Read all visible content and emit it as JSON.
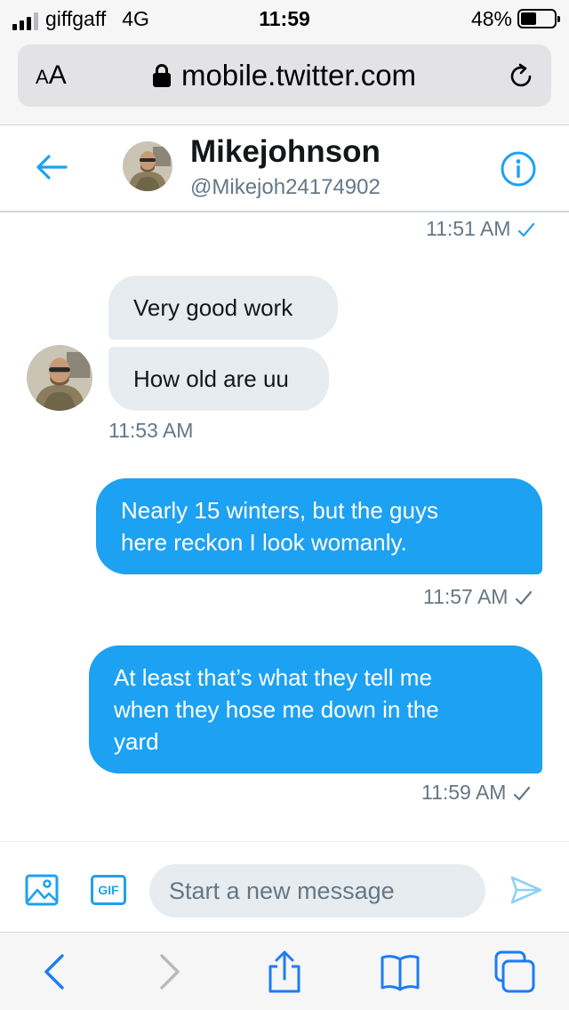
{
  "status_bar": {
    "carrier": "giffgaff",
    "network": "4G",
    "time": "11:59",
    "battery": "48%",
    "battery_level": 0.48,
    "signal_bars": 3,
    "signal_max": 4
  },
  "browser": {
    "text_size_button": "AA",
    "url": "mobile.twitter.com",
    "lock_icon": "lock-icon",
    "reload_icon": "reload-icon"
  },
  "header": {
    "back_icon": "back-arrow-icon",
    "name": "Mikejohnson",
    "handle": "@Mikejoh24174902",
    "info_icon": "info-icon"
  },
  "conversation": {
    "top_timestamp": "11:51 AM",
    "received": {
      "messages": [
        "Very good work",
        "How old are uu"
      ],
      "timestamp": "11:53 AM"
    },
    "sent": [
      {
        "lines": [
          "Nearly 15 winters, but the guys",
          "here reckon I look womanly."
        ],
        "timestamp": "11:57 AM"
      },
      {
        "lines": [
          "At least that’s what they tell me",
          "when they hose me down in the",
          "yard"
        ],
        "timestamp": "11:59 AM"
      }
    ]
  },
  "composer": {
    "media_icon": "image-icon",
    "gif_label": "GIF",
    "placeholder": "Start a new message",
    "send_icon": "send-icon"
  },
  "toolbar": {
    "back": "chevron-left-icon",
    "forward": "chevron-right-icon",
    "share": "share-icon",
    "bookmarks": "book-icon",
    "tabs": "tabs-icon"
  },
  "colors": {
    "twitter_blue": "#1da1f2",
    "received_bubble": "#e6ecf0",
    "secondary_text": "#657786"
  }
}
